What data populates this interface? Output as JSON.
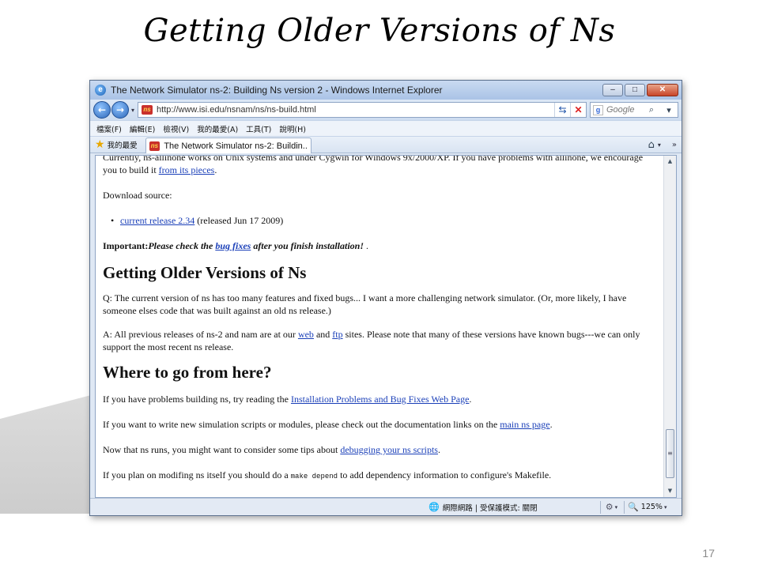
{
  "slide": {
    "title": "Getting Older Versions of Ns",
    "number": "17"
  },
  "window": {
    "title": "The Network Simulator ns-2: Building Ns version 2 - Windows Internet Explorer",
    "minimize": "–",
    "maximize": "□",
    "close": "✕"
  },
  "nav": {
    "back": "←",
    "forward": "→",
    "dropdown": "▾",
    "address": "http://www.isi.edu/nsnam/ns/ns-build.html",
    "refresh": "⇆",
    "stop": "✕",
    "search_placeholder": "Google",
    "search_icon": "⌕",
    "search_drop": "▾"
  },
  "menu": [
    "檔案(F)",
    "編輯(E)",
    "檢視(V)",
    "我的最愛(A)",
    "工具(T)",
    "說明(H)"
  ],
  "favbar": {
    "favorites_label": "我的最愛",
    "tab_title": "The Network Simulator ns-2: Buildin...",
    "home": "⌂",
    "drop": "▾",
    "more": "»"
  },
  "page": {
    "intro_prefix": "Currently, ns-allinone works on Unix systems and under Cygwin for Windows 9x/2000/XP. If you have problems with allinone, we encourage you to build it ",
    "intro_link": "from its pieces",
    "intro_suffix": ".",
    "download_label": "Download source:",
    "release_link": "current release 2.34",
    "release_note": " (released Jun 17 2009)",
    "important_label": "Important:",
    "important_pre": "Please check the ",
    "important_link": "bug fixes",
    "important_post": " after you finish installation!",
    "important_end": " .",
    "h_older": "Getting Older Versions of Ns",
    "q_text": "Q: The current version of ns has too many features and fixed bugs... I want a more challenging network simulator. (Or, more likely, I have someone elses code that was built against an old ns release.)",
    "a_prefix": "A: All previous releases of ns-2 and nam are at our ",
    "a_link_web": "web",
    "a_and": " and ",
    "a_link_ftp": "ftp",
    "a_suffix": " sites. Please note that many of these versions have known bugs---we can only support the most recent ns release.",
    "h_where": "Where to go from here?",
    "p1_prefix": "If you have problems building ns, try reading the ",
    "p1_link": "Installation Problems and Bug Fixes Web Page",
    "p1_suffix": ".",
    "p2_prefix": "If you want to write new simulation scripts or modules, please check out the documentation links on the ",
    "p2_link": "main ns page",
    "p2_suffix": ".",
    "p3_prefix": "Now that ns runs, you might want to consider some tips about ",
    "p3_link": "debugging your ns scripts",
    "p3_suffix": ".",
    "p4_prefix": "If you plan on modifing ns itself you should do a ",
    "p4_code": "make depend",
    "p4_suffix": " to add dependency information to configure's Makefile."
  },
  "scroll": {
    "up": "▲",
    "down": "▼",
    "grip": "≡"
  },
  "status": {
    "zone": "網際網路 | 受保護模式: 關閉",
    "zoom": "125%",
    "drop": "▾"
  }
}
